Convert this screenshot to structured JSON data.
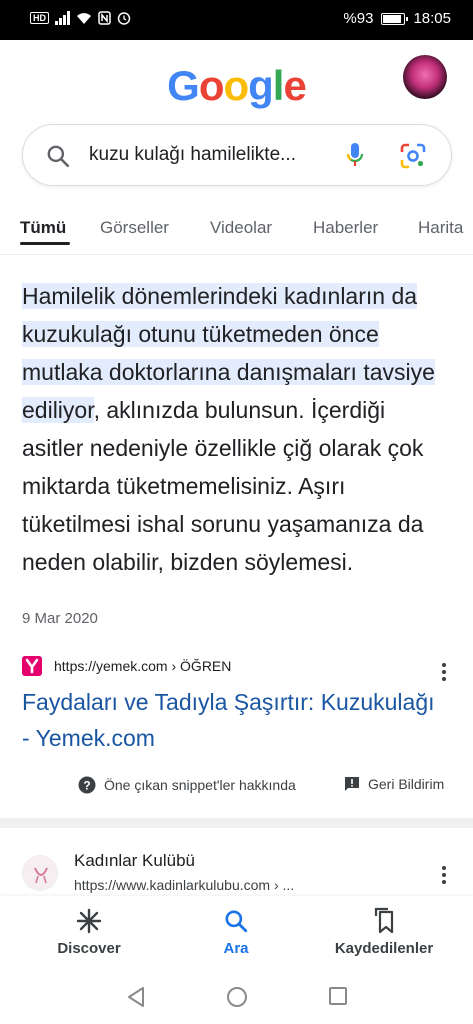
{
  "status_bar": {
    "hd_badge": "HD",
    "battery_text": "%93",
    "battery_level": 0.93,
    "time": "18:05",
    "icons": [
      "signal-icon",
      "wifi-icon",
      "nfc-icon",
      "alarm-icon",
      "battery-icon"
    ]
  },
  "header": {
    "logo_letters": [
      "G",
      "o",
      "o",
      "g",
      "l",
      "e"
    ],
    "logo_colors": [
      "#4285F4",
      "#EA4335",
      "#FBBC05",
      "#4285F4",
      "#34A853",
      "#EA4335"
    ]
  },
  "search": {
    "query": "kuzu kulağı hamilelikte..."
  },
  "tabs": [
    "Tümü",
    "Görseller",
    "Videolar",
    "Haberler",
    "Harita"
  ],
  "snippet": {
    "highlight": "Hamilelik dönemlerindeki kadınların da kuzukulağı otunu tüketmeden önce mutlaka doktorlarına danışmaları tavsiye ediliyor",
    "rest": ", aklınızda bulunsun. İçerdiği asitler nedeniyle özellikle çiğ olarak çok miktarda tüketmemelisiniz. Aşırı tüketilmesi ishal sorunu yaşamanıza da neden olabilir, bizden söylemesi.",
    "date": "9 Mar 2020",
    "source_url": "https://yemek.com › ÖĞREN",
    "source_title": "Faydaları ve Tadıyla Şaşırtır: Kuzukulağı - Yemek.com",
    "about_label": "Öne çıkan snippet'ler hakkında",
    "feedback_label": "Geri Bildirim"
  },
  "result2": {
    "site_name": "Kadınlar Kulübü",
    "url": "https://www.kadinlarkulubu.com › ..."
  },
  "bottom_nav": {
    "discover": "Discover",
    "search": "Ara",
    "saved": "Kaydedilenler"
  },
  "colors": {
    "accent": "#1a73e8",
    "link": "#1a56a2",
    "highlight": "#e3ecfc",
    "source_brand": "#e5006e"
  }
}
